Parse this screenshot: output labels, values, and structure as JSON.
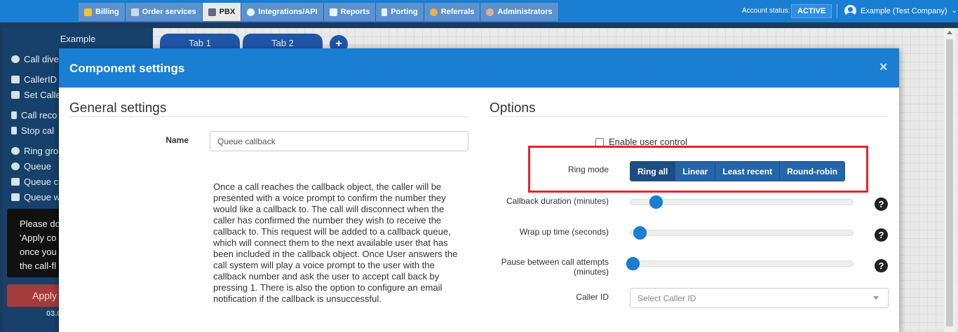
{
  "nav": {
    "tabs": [
      {
        "label": "Billing",
        "icon": "billing-icon"
      },
      {
        "label": "Order services",
        "icon": "cart-icon"
      },
      {
        "label": "PBX",
        "icon": "pbx-icon"
      },
      {
        "label": "Integrations/API",
        "icon": "gear-icon"
      },
      {
        "label": "Reports",
        "icon": "report-icon"
      },
      {
        "label": "Porting",
        "icon": "phone-icon"
      },
      {
        "label": "Referrals",
        "icon": "referral-icon"
      },
      {
        "label": "Administrators",
        "icon": "admin-icon"
      }
    ],
    "active_tab": "PBX",
    "account_status_label": "Account status:",
    "account_status_value": "ACTIVE",
    "user": "Example (Test Company)"
  },
  "background": {
    "sidebar_title": "Example",
    "sidebar_items": [
      "Call dive",
      "CallerID",
      "Set Calle",
      "Call reco",
      "Stop cal",
      "Ring gro",
      "Queue",
      "Queue c",
      "Queue w"
    ],
    "sidebar_note": "Please do 'Apply co once you the call-fl",
    "apply_label": "Apply",
    "version": "03.0",
    "canvas_tabs": [
      "Tab 1",
      "Tab 2"
    ],
    "add_tab": "+"
  },
  "modal": {
    "title": "Component settings",
    "close": "×",
    "general": {
      "title": "General settings",
      "name_label": "Name",
      "name_value": "Queue callback",
      "description": "Once a call reaches the callback object, the caller will be presented with a voice prompt to confirm the number they would like a callback to. The call will disconnect when the caller has confirmed the number they wish to receive the callback to. This request will be added to a callback queue, which will connect them to the next available user that has been included in the callback object. Once User answers the call system will play a voice prompt to the user with the callback number and ask the user to accept call back by pressing 1. There is also the option to configure an email notification if the callback is unsuccessful."
    },
    "options": {
      "title": "Options",
      "enable_user_control": "Enable user control",
      "ring_mode_label": "Ring mode",
      "ring_modes": [
        "Ring all",
        "Linear",
        "Least recent",
        "Round-robin"
      ],
      "ring_mode_selected": "Ring all",
      "callback_duration_label": "Callback duration (minutes)",
      "wrap_up_label": "Wrap up time (seconds)",
      "pause_label": "Pause between call attempts (minutes)",
      "caller_id_label": "Caller ID",
      "caller_id_placeholder": "Select Caller ID",
      "help_glyph": "?"
    }
  }
}
